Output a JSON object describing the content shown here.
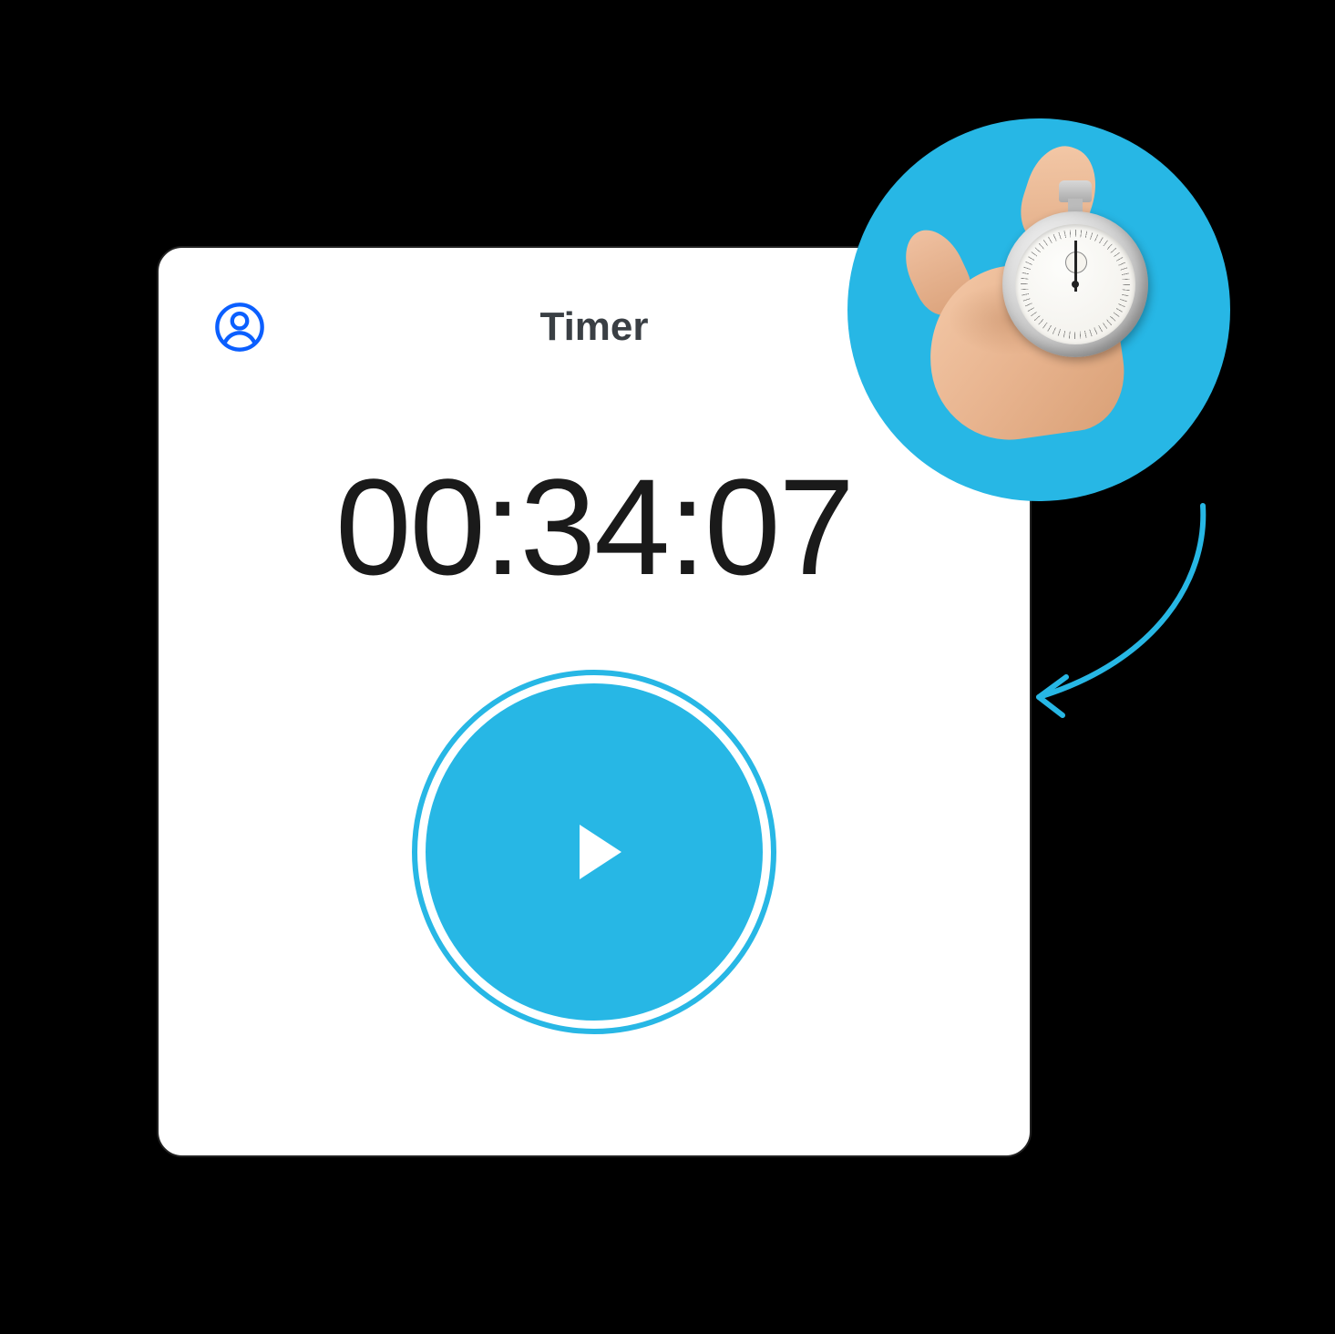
{
  "header": {
    "title": "Timer"
  },
  "timer": {
    "display": "00:34:07"
  },
  "colors": {
    "accent": "#27b7e5",
    "user_icon": "#0b5fff"
  }
}
